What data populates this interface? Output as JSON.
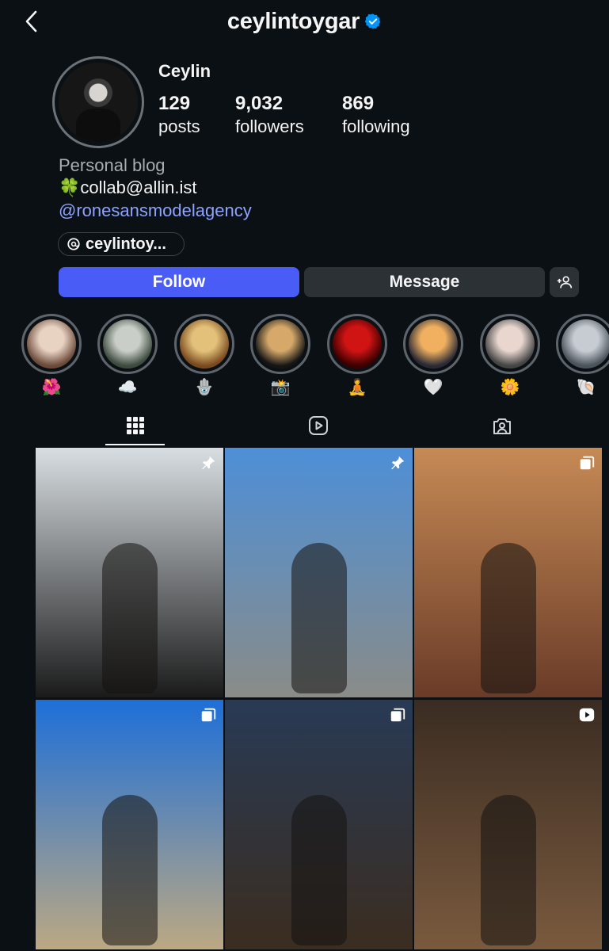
{
  "header": {
    "username": "ceylintoygar",
    "verified": true
  },
  "profile": {
    "name": "Ceylin",
    "stats": [
      {
        "value": "129",
        "label": "posts"
      },
      {
        "value": "9,032",
        "label": "followers"
      },
      {
        "value": "869",
        "label": "following"
      }
    ],
    "category": "Personal blog",
    "bio_line": "🍀collab@allin.ist",
    "mention": "@ronesansmodelagency",
    "threads_handle": "ceylintoy..."
  },
  "actions": {
    "follow": "Follow",
    "message": "Message"
  },
  "highlights": [
    {
      "emoji": "🌺",
      "color_a": "#e8d2c2",
      "color_b": "#6b4a3a"
    },
    {
      "emoji": "☁️",
      "color_a": "#c9cfc8",
      "color_b": "#3d4a3e"
    },
    {
      "emoji": "🪬",
      "color_a": "#e3c17a",
      "color_b": "#7a4a1f"
    },
    {
      "emoji": "📸",
      "color_a": "#d6a96a",
      "color_b": "#151515"
    },
    {
      "emoji": "🧘",
      "color_a": "#d01414",
      "color_b": "#3a0000"
    },
    {
      "emoji": "🤍",
      "color_a": "#f0b060",
      "color_b": "#2a2a35"
    },
    {
      "emoji": "🌼",
      "color_a": "#e8d6cf",
      "color_b": "#444"
    },
    {
      "emoji": "🐚",
      "color_a": "#c7ccd2",
      "color_b": "#4a525a"
    }
  ],
  "grid": [
    {
      "badge": "pin",
      "top": "#d8dee2",
      "bottom": "#1a1a1a"
    },
    {
      "badge": "pin",
      "top": "#4d8fd8",
      "bottom": "#8a8c88"
    },
    {
      "badge": "carousel",
      "top": "#c68a55",
      "bottom": "#6a3b28"
    },
    {
      "badge": "carousel",
      "top": "#1d6fd8",
      "bottom": "#bca883"
    },
    {
      "badge": "carousel",
      "top": "#283a55",
      "bottom": "#3b2d20"
    },
    {
      "badge": "reel",
      "top": "#3a2c22",
      "bottom": "#7a5a3e"
    }
  ]
}
